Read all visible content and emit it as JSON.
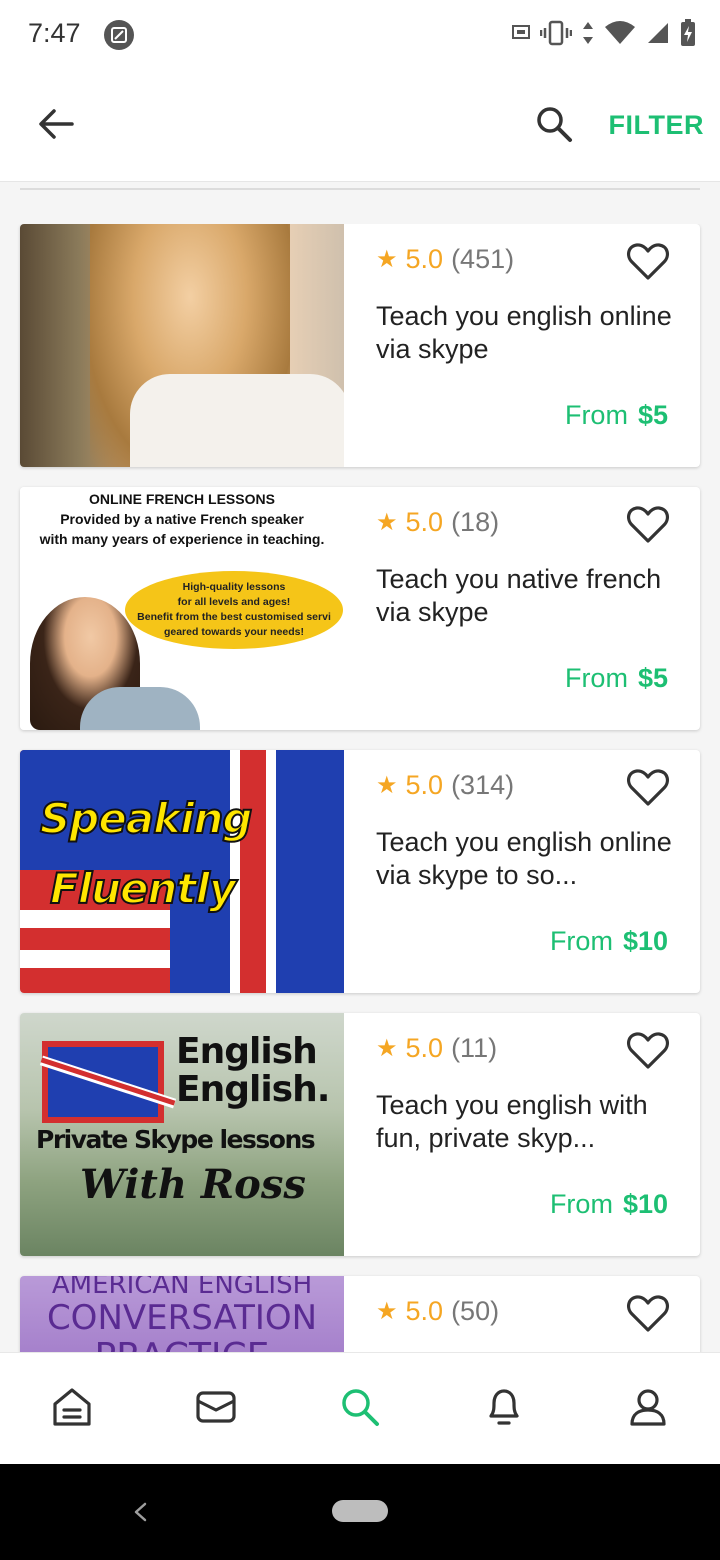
{
  "status_bar": {
    "time": "7:47",
    "icons": [
      "app-notification-icon",
      "cast-icon",
      "vibrate-icon",
      "data-arrows-icon",
      "wifi-icon",
      "signal-icon",
      "battery-charging-icon"
    ]
  },
  "toolbar": {
    "back_icon": "arrow-left-icon",
    "search_icon": "search-icon",
    "filter_label": "FILTER"
  },
  "theme": {
    "accent": "#1dbf73",
    "star": "#f5a623",
    "text": "#222222"
  },
  "gigs": [
    {
      "rating": "5.0",
      "reviews": "(451)",
      "title": "Teach you english online via skype",
      "price_prefix": "From",
      "price": "$5"
    },
    {
      "rating": "5.0",
      "reviews": "(18)",
      "title": "Teach you native french via skype",
      "price_prefix": "From",
      "price": "$5",
      "thumb_text": {
        "banner_line1": "ONLINE FRENCH LESSONS",
        "banner_line2": "Provided by a native French speaker",
        "banner_line3": "with many years of experience in teaching.",
        "bubble_line1": "High-quality lessons",
        "bubble_line2": "for all levels and ages!",
        "bubble_line3": "Benefit from the best customised servi",
        "bubble_line4": "geared towards your needs!"
      }
    },
    {
      "rating": "5.0",
      "reviews": "(314)",
      "title": "Teach you english online via skype to so...",
      "price_prefix": "From",
      "price": "$10",
      "thumb_text": {
        "line1": "Speaking",
        "line2": "Fluently"
      }
    },
    {
      "rating": "5.0",
      "reviews": "(11)",
      "title": "Teach you english with fun, private skyp...",
      "price_prefix": "From",
      "price": "$10",
      "thumb_text": {
        "line1": "English",
        "line2": "English.",
        "line3": "Private Skype lessons",
        "line4": "With Ross"
      }
    },
    {
      "rating": "5.0",
      "reviews": "(50)",
      "thumb_text": {
        "line1": "AMERICAN ENGLISH",
        "line2": "CONVERSATION",
        "line3": "PRACTICE"
      }
    }
  ],
  "bottom_nav": {
    "items": [
      "home-icon",
      "inbox-icon",
      "search-icon",
      "notifications-icon",
      "profile-icon"
    ],
    "active": "search-icon"
  },
  "system_nav": {
    "back_icon": "system-back-icon",
    "home_icon": "system-home-pill"
  }
}
